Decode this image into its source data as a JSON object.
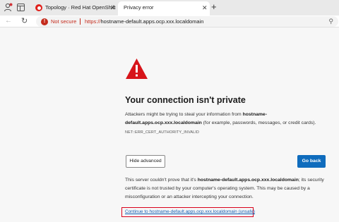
{
  "browser": {
    "tabs": [
      {
        "title": "Topology · Red Hat OpenShift",
        "close": "✕"
      },
      {
        "title": "Privacy error",
        "close": "✕"
      }
    ],
    "new_tab": "+",
    "nav": {
      "back": "←",
      "reload": "↻"
    },
    "address": {
      "security_label": "Not secure",
      "security_icon": "!",
      "url_scheme": "https://",
      "url_rest": "hostname-default.apps.ocp.xxx.localdomain",
      "zoom_icon": "⚲"
    }
  },
  "page": {
    "heading": "Your connection isn't private",
    "intro_prefix": "Attackers might be trying to steal your information from ",
    "intro_host": "hostname-default.apps.ocp.xxx.localdomain",
    "intro_suffix": " (for example, passwords, messages, or credit cards).",
    "error_code": "NET::ERR_CERT_AUTHORITY_INVALID",
    "hide_advanced": "Hide advanced",
    "go_back": "Go back",
    "details_prefix": "This server couldn't prove that it's ",
    "details_host": "hostname-default.apps.ocp.xxx.localdomain",
    "details_suffix": "; its security certificate is not trusted by your computer's operating system. This may be caused by a misconfiguration or an attacker intercepting your connection.",
    "continue_link": "Continue to hostname-default.apps.ocp.xxx.localdomain (unsafe)"
  },
  "colors": {
    "warning": "#d7141a",
    "not_secure": "#c42b1c",
    "primary_button": "#0f6cbd",
    "link": "#0f5db4",
    "highlight_box": "#d9001b"
  },
  "icons": [
    "profile-icon",
    "tab-actions-icon",
    "openshift-favicon",
    "back-icon",
    "reload-icon",
    "not-secure-icon",
    "zoom-icon",
    "warning-icon"
  ]
}
